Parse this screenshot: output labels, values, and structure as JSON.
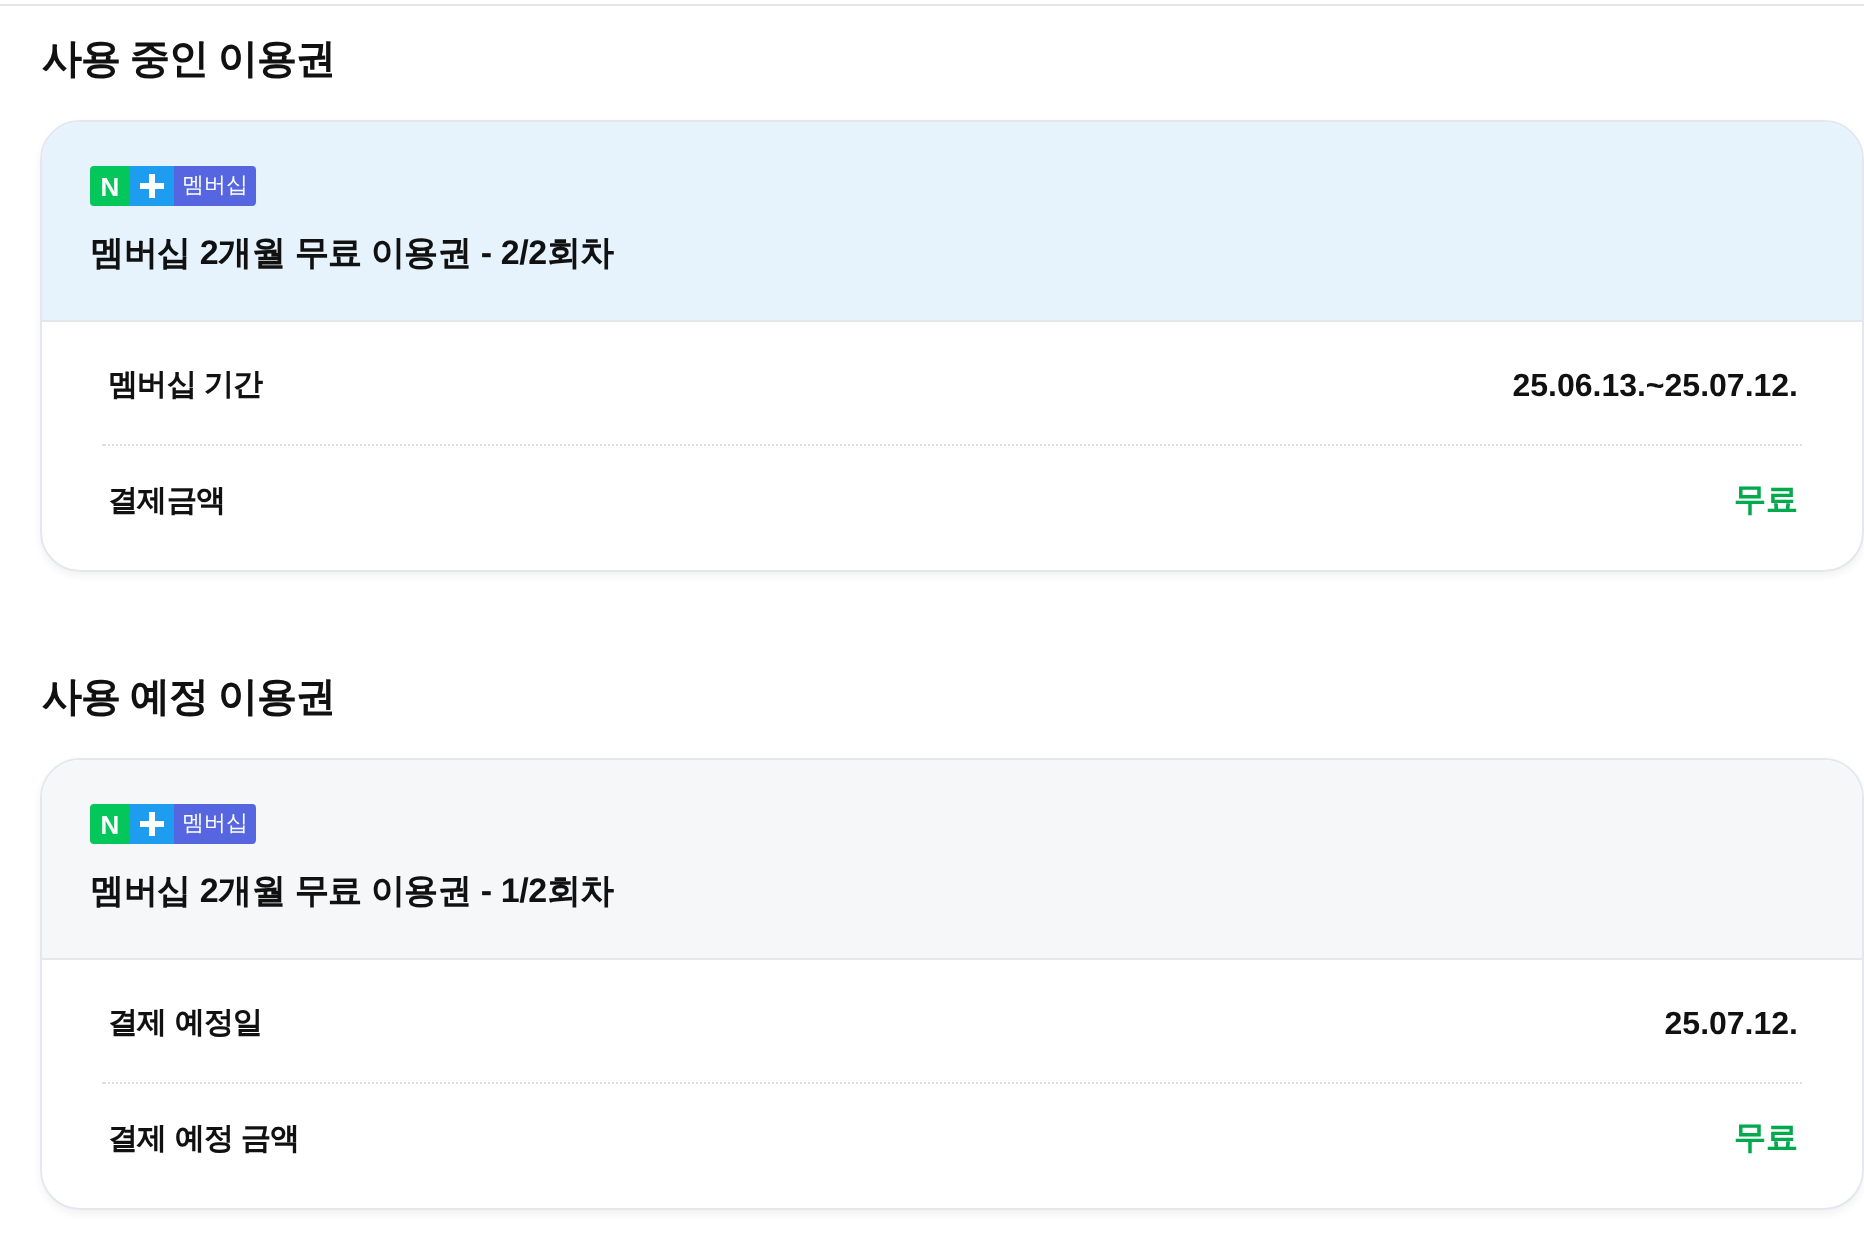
{
  "sections": [
    {
      "heading": "사용 중인 이용권",
      "color": "#e6f3fd",
      "badge": {
        "logo": "N",
        "label": "멤버십"
      },
      "title": "멤버십 2개월 무료 이용권 - 2/2회차",
      "rows": [
        {
          "label": "멤버십 기간",
          "value": "25.06.13.~25.07.12.",
          "emphasis": false
        },
        {
          "label": "결제금액",
          "value": "무료",
          "emphasis": true
        }
      ]
    },
    {
      "heading": "사용 예정 이용권",
      "color": "#f6f7f9",
      "badge": {
        "logo": "N",
        "label": "멤버십"
      },
      "title": "멤버십 2개월 무료 이용권 - 1/2회차",
      "rows": [
        {
          "label": "결제 예정일",
          "value": "25.07.12.",
          "emphasis": false
        },
        {
          "label": "결제 예정 금액",
          "value": "무료",
          "emphasis": true
        }
      ]
    }
  ]
}
